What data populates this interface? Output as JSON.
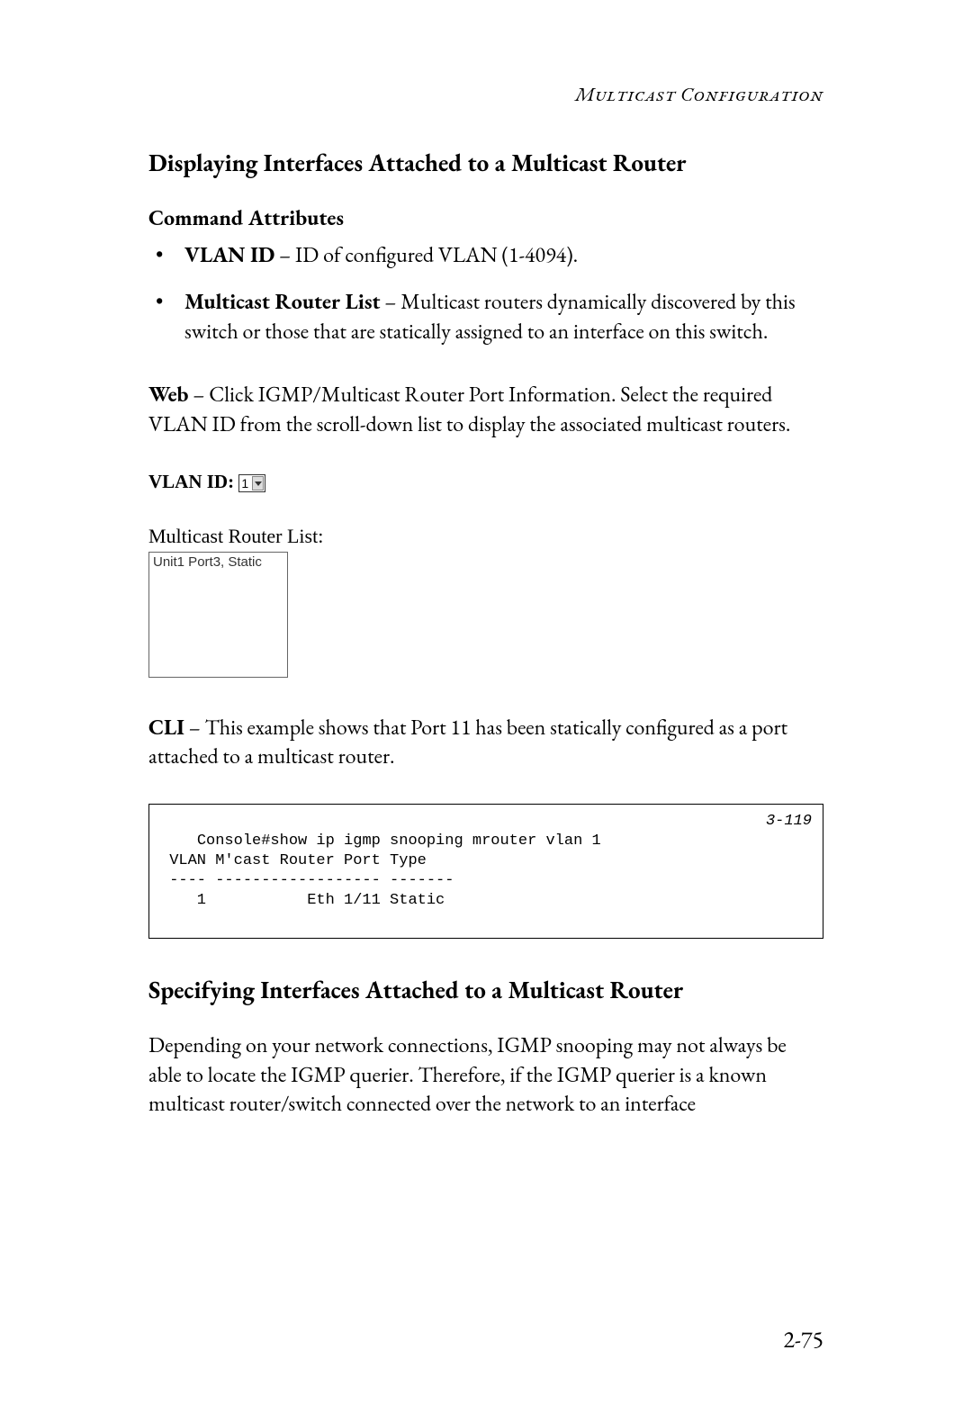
{
  "header": {
    "title": "Multicast Configuration"
  },
  "section1": {
    "title": "Displaying Interfaces Attached to a Multicast Router",
    "command_attributes_label": "Command Attributes",
    "attr1_name": "VLAN ID",
    "attr1_desc": " – ID of configured VLAN (1-4094).",
    "attr2_name": "Multicast Router List",
    "attr2_desc": " – Multicast routers dynamically discovered by this switch or those that are statically assigned to an interface on this switch.",
    "web_label": "Web",
    "web_text": " – Click IGMP/Multicast Router Port Information. Select the required VLAN ID from the scroll-down list to display the associated multicast routers.",
    "vlan_id_label": "VLAN ID:",
    "vlan_id_value": "1",
    "mrl_label": "Multicast Router List:",
    "mrl_item": "Unit1 Port3, Static",
    "cli_label": "CLI",
    "cli_text": " – This example shows that Port 11 has been statically configured as a port attached to a multicast router.",
    "cli_output": "Console#show ip igmp snooping mrouter vlan 1\n VLAN M'cast Router Port Type\n ---- ------------------ -------\n    1           Eth 1/11 Static",
    "cli_ref": "3-119"
  },
  "section2": {
    "title": "Specifying Interfaces Attached to a Multicast Router",
    "body": "Depending on your network connections, IGMP snooping may not always be able to locate the IGMP querier. Therefore, if the IGMP querier is a known multicast router/switch connected over the network to an interface"
  },
  "page_number": "2-75"
}
